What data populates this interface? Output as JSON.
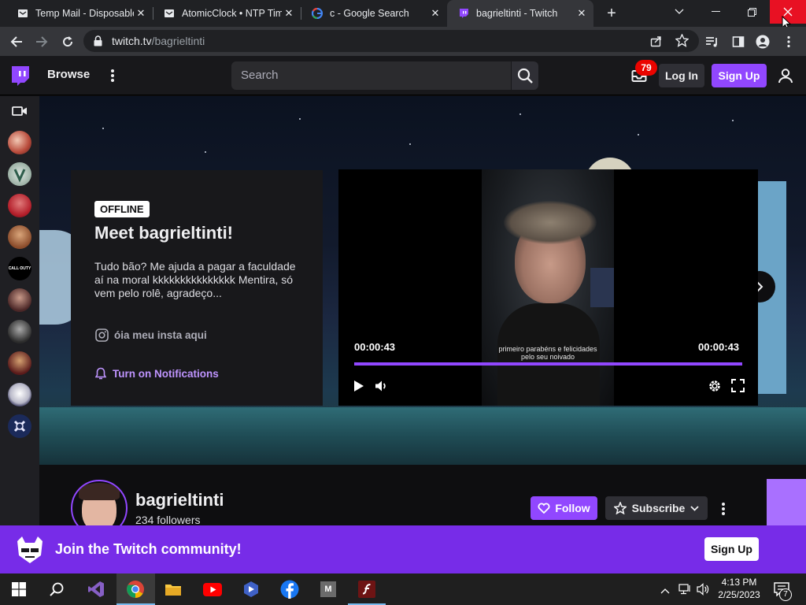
{
  "browser": {
    "tabs": [
      {
        "title": "Temp Mail - Disposable",
        "active": false
      },
      {
        "title": "AtomicClock • NTP Time",
        "active": false
      },
      {
        "title": "c - Google Search",
        "active": false
      },
      {
        "title": "bagrieltinti - Twitch",
        "active": true
      }
    ],
    "url_host": "twitch.tv",
    "url_path": "/bagrieltinti"
  },
  "twitch_nav": {
    "browse_label": "Browse",
    "search_placeholder": "Search",
    "notification_count": "79",
    "login_label": "Log In",
    "signup_label": "Sign Up"
  },
  "channel_card": {
    "status_badge": "OFFLINE",
    "heading": "Meet bagrieltinti!",
    "description": "Tudo bão? Me ajuda a pagar a faculdade aí na moral kkkkkkkkkkkkkkk Mentira, só vem pelo rolê, agradeço...",
    "insta_label": "óia meu insta aqui",
    "notify_label": "Turn on Notifications"
  },
  "player": {
    "time_left": "00:00:43",
    "time_right": "00:00:43",
    "caption_line1": "primeiro parabéns e felicidades",
    "caption_line2": "pelo seu noivado",
    "progress": 1.0
  },
  "channel_bar": {
    "name": "bagrieltinti",
    "followers": "234 followers",
    "follow_label": "Follow",
    "subscribe_label": "Subscribe"
  },
  "join_banner": {
    "text": "Join the Twitch community!",
    "signup_label": "Sign Up"
  },
  "taskbar": {
    "time": "4:13 PM",
    "date": "2/25/2023",
    "notification_count": "7"
  },
  "colors": {
    "twitch_purple": "#9147ff",
    "join_bar": "#772ce8",
    "close_red": "#e81123"
  }
}
